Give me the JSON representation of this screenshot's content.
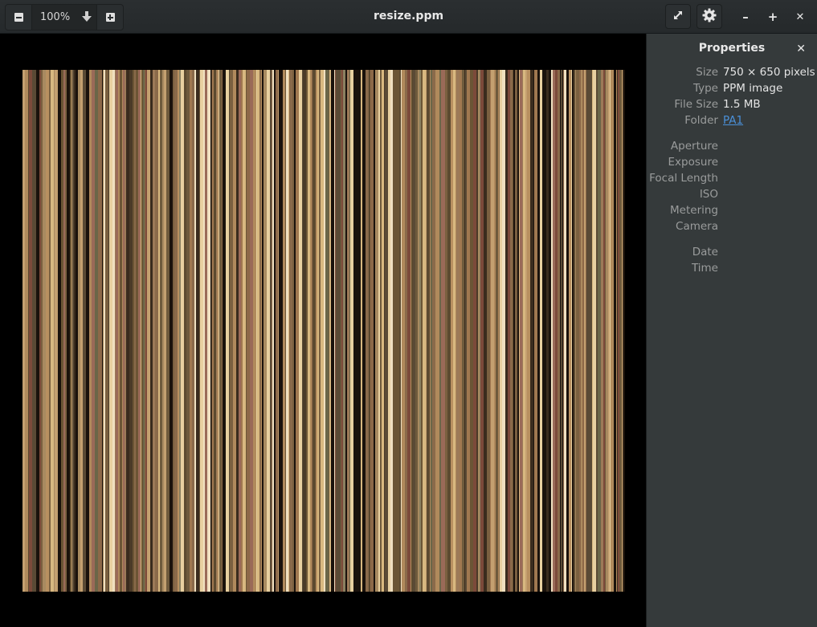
{
  "header": {
    "title": "resize.ppm",
    "zoom_level": "100%",
    "icons": {
      "zoom_out": "minus-square-icon",
      "zoom_in": "plus-square-icon",
      "zoom_menu": "arrow-down-icon",
      "fullscreen": "fullscreen-icon",
      "settings": "gear-icon",
      "minimize": "minimize-icon",
      "maximize": "maximize-icon",
      "close": "close-icon"
    },
    "minimize_glyph": "–",
    "maximize_glyph": "+",
    "close_glyph": "✕"
  },
  "properties": {
    "title": "Properties",
    "close_glyph": "✕",
    "rows": [
      {
        "label": "Size",
        "value": "750 × 650 pixels"
      },
      {
        "label": "Type",
        "value": "PPM image"
      },
      {
        "label": "File Size",
        "value": "1.5 MB"
      },
      {
        "label": "Folder",
        "value": "PA1"
      },
      {
        "label": "Aperture",
        "value": ""
      },
      {
        "label": "Exposure",
        "value": ""
      },
      {
        "label": "Focal Length",
        "value": ""
      },
      {
        "label": "ISO",
        "value": ""
      },
      {
        "label": "Metering",
        "value": ""
      },
      {
        "label": "Camera",
        "value": ""
      },
      {
        "label": "Date",
        "value": ""
      },
      {
        "label": "Time",
        "value": ""
      }
    ]
  },
  "image": {
    "colors": {
      "background": "#000000",
      "stripe_palette": [
        "#8a6a4a",
        "#a07850",
        "#6b5535",
        "#b89060",
        "#5a4a35",
        "#9c7a58",
        "#c4a070",
        "#4a3a28",
        "#7a6040",
        "#a88a60",
        "#d8b880",
        "#3a2c1e",
        "#8c6848",
        "#6e5a3c",
        "#b08a5c",
        "#9a6a58",
        "#7c4a3a",
        "#e8d0a0",
        "#f0e0c0",
        "#5c4a30",
        "#8a8060",
        "#6a6648"
      ]
    }
  }
}
